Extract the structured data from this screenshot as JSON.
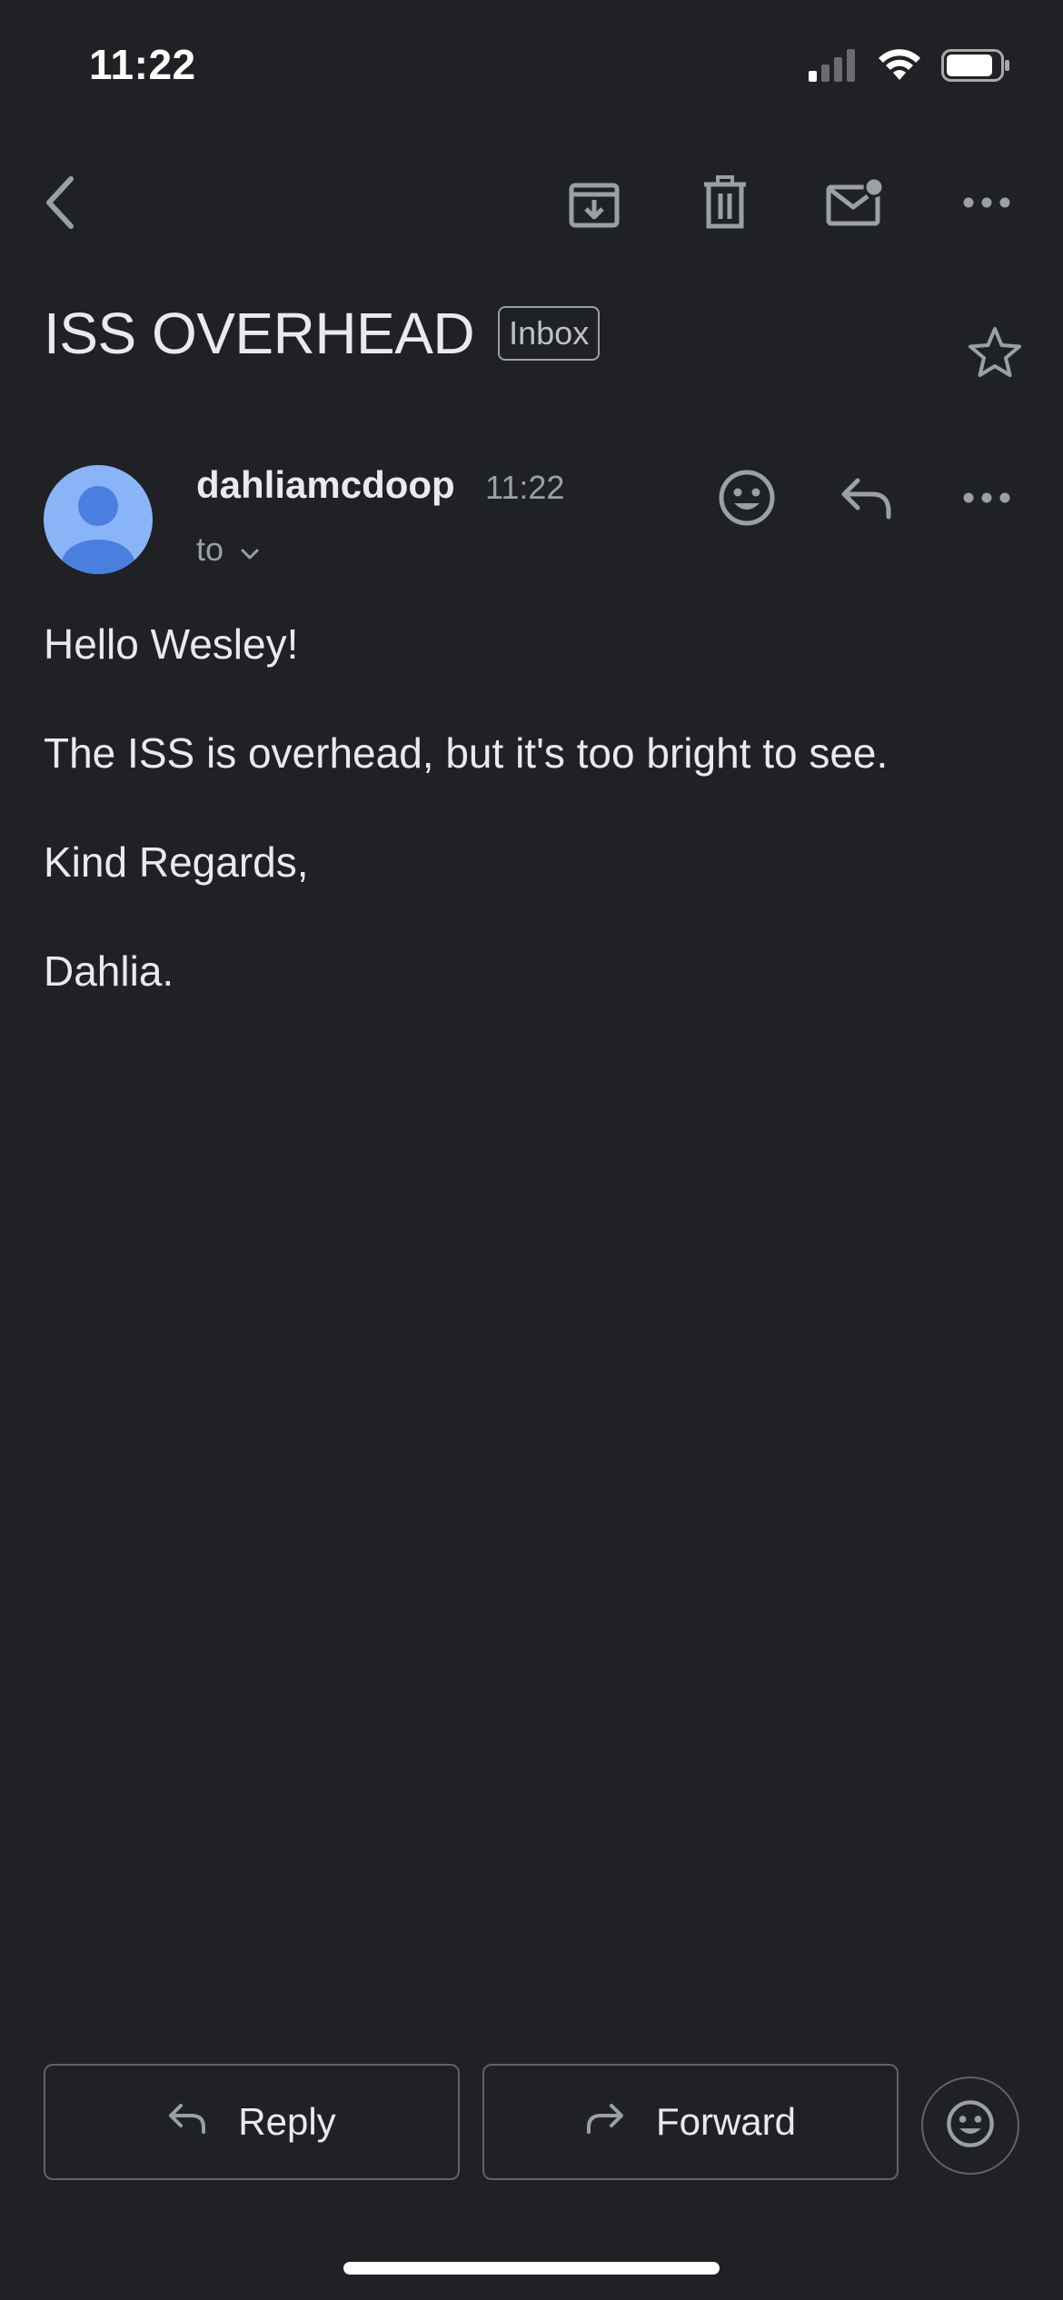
{
  "status_bar": {
    "time": "11:22",
    "icons": [
      "cellular-signal-icon",
      "wifi-icon",
      "battery-icon"
    ]
  },
  "toolbar": {
    "back_icon": "chevron-left-icon",
    "archive_icon": "archive-icon",
    "delete_icon": "trash-icon",
    "mark_unread_icon": "mail-unread-icon",
    "more_icon": "more-horizontal-icon"
  },
  "message": {
    "subject": "ISS OVERHEAD",
    "label": "Inbox",
    "star_icon": "star-outline-icon",
    "sender": "dahliamcdoop",
    "time": "11:22",
    "recipient_prefix": "to",
    "body": [
      "Hello Wesley!",
      "The ISS is overhead, but it's too bright to see.",
      "Kind Regards,",
      "Dahlia."
    ]
  },
  "bottom_actions": {
    "reply_label": "Reply",
    "forward_label": "Forward"
  },
  "colors": {
    "background": "#202124",
    "text": "#e8eaed",
    "muted": "#9aa0a6",
    "avatar_bg": "#8ab4f8",
    "avatar_fg": "#4285f4",
    "border": "#5f6368"
  }
}
